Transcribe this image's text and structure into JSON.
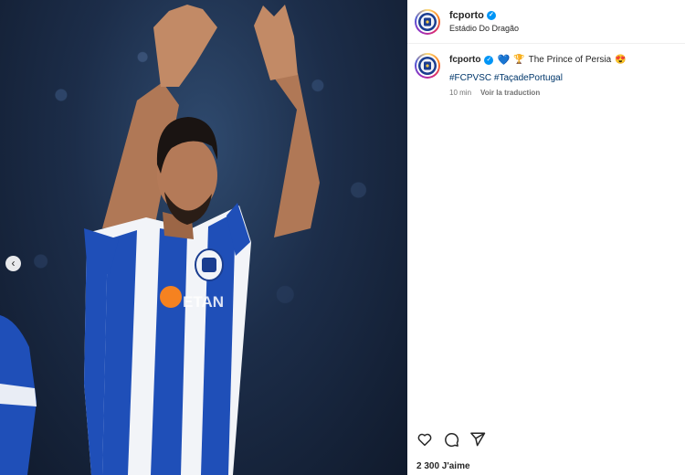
{
  "post": {
    "username": "fcporto",
    "location": "Estádio Do Dragão",
    "caption_text": "The Prince of Persia",
    "caption_heart": "💙",
    "caption_emoji_1": "🏆",
    "caption_emoji_2": "😍",
    "hashtags": "#FCPVSC #TaçadePortugal",
    "time_ago": "10 min",
    "translate_label": "Voir la traduction",
    "likes": "2 300 J'aime"
  },
  "icons": {
    "previous": "chevron-left-icon",
    "verified": "verified-badge-icon",
    "like": "heart-icon",
    "comment": "comment-icon",
    "share": "send-icon"
  },
  "colors": {
    "verified": "#0095f6",
    "jersey_blue": "#1f4fb8",
    "hashtag": "#00376b"
  }
}
